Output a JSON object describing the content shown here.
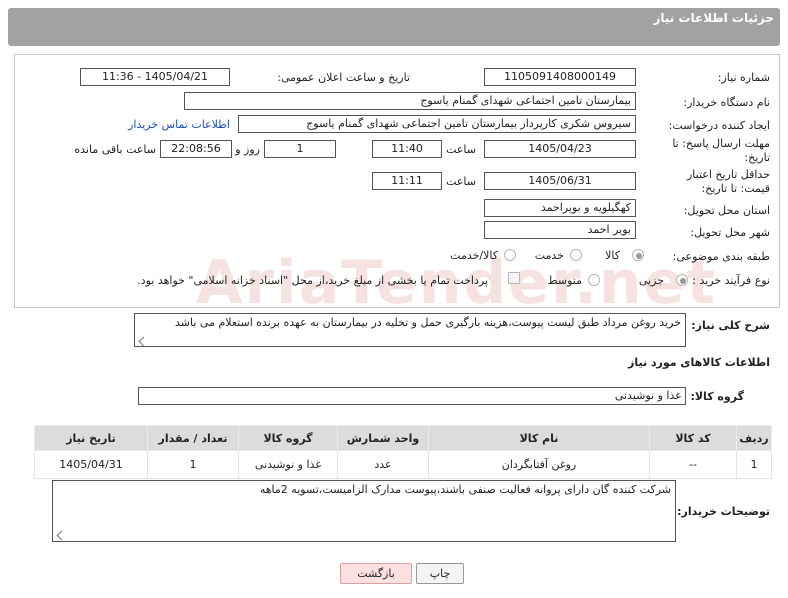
{
  "header": {
    "title": "جزئیات اطلاعات نیاز"
  },
  "fields": {
    "need_number_label": "شماره نیاز:",
    "need_number": "1105091408000149",
    "announce_label": "تاریخ و ساعت اعلان عمومی:",
    "announce_value": "1405/04/21 - 11:36",
    "buyer_org_label": "نام دستگاه خریدار:",
    "buyer_org": "بیمارستان تامین اجتماعی شهدای گمنام یاسوج",
    "creator_label": "ایجاد کننده درخواست:",
    "creator": "سیروس شکری کارپرداز بیمارستان تامین اجتماعی شهدای گمنام یاسوج",
    "contact_link": "اطلاعات تماس خریدار",
    "deadline_label": "مهلت ارسال پاسخ: تا تاریخ:",
    "deadline_date": "1405/04/23",
    "time_label": "ساعت",
    "deadline_time": "11:40",
    "days": "1",
    "days_label": "روز و",
    "remaining_time": "22:08:56",
    "remaining_label": "ساعت باقی مانده",
    "price_validity_label": "حداقل تاریخ اعتبار قیمت: تا تاریخ:",
    "price_validity_date": "1405/06/31",
    "price_validity_time": "11:11",
    "province_label": "استان محل تحویل:",
    "province": "کهگیلویه و بویراحمد",
    "city_label": "شهر محل تحویل:",
    "city": "بویر احمد",
    "category_label": "طبقه بندی موضوعی:",
    "category_options": [
      "کالا",
      "خدمت",
      "کالا/خدمت"
    ],
    "process_label": "نوع فرآیند خرید :",
    "process_options": [
      "جزیی",
      "متوسط"
    ],
    "payment_note": "پرداخت تمام یا بخشی از مبلغ خرید،از محل \"اسناد خزانه اسلامی\" خواهد بود."
  },
  "description": {
    "label": "شرح کلی نیاز:",
    "text": "خرید روغن مرداد طبق لیست پیوست،هزینه بارگیری حمل و تخلیه در بیمارستان به عهده برنده استعلام می باشد"
  },
  "goods": {
    "section_title": "اطلاعات کالاهای مورد نیاز",
    "group_label": "گروه کالا:",
    "group_value": "غذا و نوشیدنی",
    "table": {
      "headers": [
        "ردیف",
        "کد کالا",
        "نام کالا",
        "واحد شمارش",
        "گروه کالا",
        "تعداد / مقدار",
        "تاریخ نیاز"
      ],
      "rows": [
        [
          "1",
          "--",
          "روغن آفتابگردان",
          "عدد",
          "غذا و نوشیدنی",
          "1",
          "1405/04/31"
        ]
      ]
    }
  },
  "buyer_notes": {
    "label": "توضیحات خریدار:",
    "text": "شرکت کننده گان دارای پروانه فعالیت صنفی باشند،پیوست مدارک الزامیست،تسویه 2ماهه"
  },
  "buttons": {
    "print": "چاپ",
    "back": "بازگشت"
  },
  "watermark": "AriaTender.net",
  "colors": {
    "header_bg": "#a2a2a2",
    "link": "#1a4fb5",
    "back_button_bg": "#fde0e0"
  }
}
